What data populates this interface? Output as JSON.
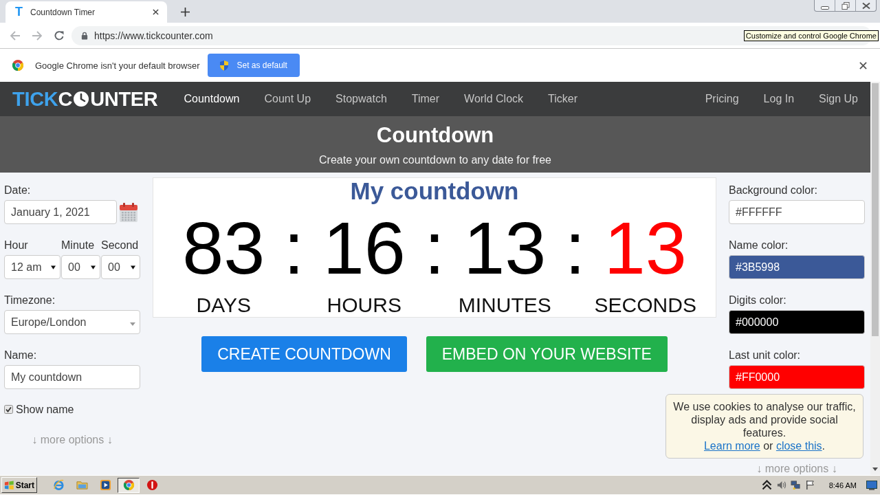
{
  "browser": {
    "tabs": [
      {
        "favicon": "T",
        "title": "Countdown Timer",
        "selected": true
      }
    ],
    "address": "https://www.tickcounter.com",
    "tooltip": "Customize and control Google Chrome",
    "infobar": {
      "message": "Google Chrome isn't your default browser",
      "button": "Set as default"
    }
  },
  "site": {
    "logo": {
      "accent": "TICK",
      "main_start": "C",
      "main_end": "UNTER"
    },
    "nav": [
      {
        "label": "Countdown",
        "selected": true
      },
      {
        "label": "Count Up",
        "selected": false
      },
      {
        "label": "Stopwatch",
        "selected": false
      },
      {
        "label": "Timer",
        "selected": false
      },
      {
        "label": "World Clock",
        "selected": false
      },
      {
        "label": "Ticker",
        "selected": false
      }
    ],
    "nav_right": [
      {
        "label": "Pricing",
        "selected": false
      },
      {
        "label": "Log In",
        "selected": false
      },
      {
        "label": "Sign Up",
        "selected": false
      }
    ]
  },
  "hero": {
    "title": "Countdown",
    "subtitle": "Create your own countdown to any date for free"
  },
  "form": {
    "date": {
      "label": "Date:",
      "value": "January 1, 2021"
    },
    "time": [
      {
        "label": "Hour",
        "value": "12 am"
      },
      {
        "label": "Minute",
        "value": "00"
      },
      {
        "label": "Second",
        "value": "00"
      }
    ],
    "timezone": {
      "label": "Timezone:",
      "value": "Europe/London"
    },
    "name": {
      "label": "Name:",
      "value": "My countdown"
    },
    "show_name": {
      "label": "Show name",
      "checked": true
    },
    "more_options": "↓ more options ↓"
  },
  "countdown": {
    "name": "My countdown",
    "units": [
      {
        "value": "83",
        "label": "DAYS"
      },
      {
        "value": "16",
        "label": "HOURS"
      },
      {
        "value": "13",
        "label": "MINUTES"
      },
      {
        "value": "13",
        "label": "SECONDS"
      }
    ],
    "separators": [
      ":",
      ":",
      ":"
    ]
  },
  "buttons": [
    {
      "label": "CREATE COUNTDOWN",
      "kind": "primary"
    },
    {
      "label": "EMBED ON YOUR WEBSITE",
      "kind": "success"
    }
  ],
  "colors": [
    {
      "label": "Background color:",
      "value": "#FFFFFF",
      "color": "#ffffff"
    },
    {
      "label": "Name color:",
      "value": "#3B5998",
      "color": "#3b5998"
    },
    {
      "label": "Digits color:",
      "value": "#000000",
      "color": "#000000"
    },
    {
      "label": "Last unit color:",
      "value": "#FF0000",
      "color": "#ff0000"
    }
  ],
  "more_options_right": "↓ more options ↓",
  "cookie_notice": {
    "message": "We use cookies to analyse our traffic, display ads and provide social features.",
    "links": [
      "Learn more",
      "close this"
    ],
    "joiner": "or",
    "end": "."
  },
  "taskbar": {
    "start": "Start",
    "apps": [
      {
        "kind": "ie",
        "selected": false
      },
      {
        "kind": "folder",
        "selected": false
      },
      {
        "kind": "media",
        "selected": false
      },
      {
        "kind": "chrome",
        "selected": true
      },
      {
        "kind": "stop",
        "selected": false
      }
    ],
    "clock": "8:46 AM"
  }
}
